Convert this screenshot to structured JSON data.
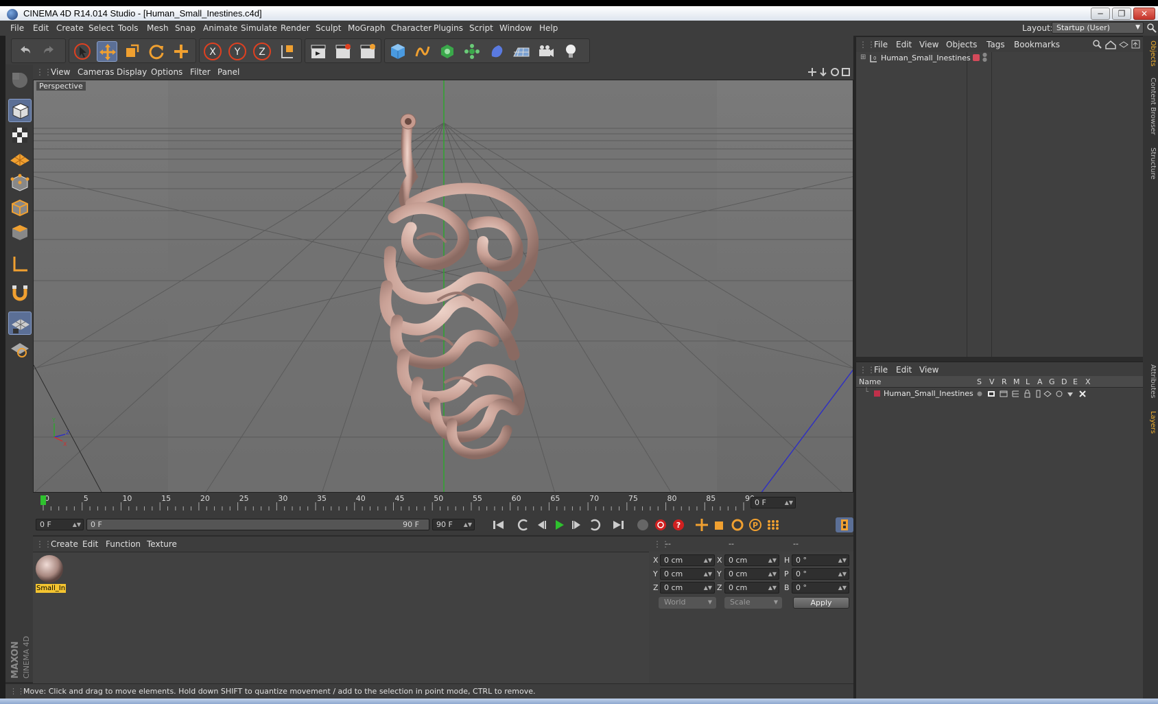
{
  "window": {
    "title": "CINEMA 4D R14.014 Studio - [Human_Small_Inestines.c4d]",
    "min": "─",
    "max": "❐",
    "close": "✕"
  },
  "menu": [
    "File",
    "Edit",
    "Create",
    "Select",
    "Tools",
    "Mesh",
    "Snap",
    "Animate",
    "Simulate",
    "Render",
    "Sculpt",
    "MoGraph",
    "Character",
    "Plugins",
    "Script",
    "Window",
    "Help"
  ],
  "layout": {
    "label": "Layout:",
    "value": "Startup (User)"
  },
  "viewport": {
    "menu": [
      "View",
      "Cameras",
      "Display",
      "Options",
      "Filter",
      "Panel"
    ],
    "label": "Perspective",
    "axes": {
      "x": "X",
      "y": "Y",
      "z": "Z"
    }
  },
  "timeline": {
    "ticks": [
      "0",
      "5",
      "10",
      "15",
      "20",
      "25",
      "30",
      "35",
      "40",
      "45",
      "50",
      "55",
      "60",
      "65",
      "70",
      "75",
      "80",
      "85",
      "90"
    ],
    "current_frame": "0 F",
    "start": "0 F",
    "range_start": "0 F",
    "range_end": "90 F",
    "end": "90 F"
  },
  "materials": {
    "menu": [
      "Create",
      "Edit",
      "Function",
      "Texture"
    ],
    "items": [
      {
        "name": "Small_In"
      }
    ]
  },
  "coordinates": {
    "headers": [
      "--",
      "--",
      "--"
    ],
    "rows": [
      {
        "a": "X",
        "av": "0 cm",
        "b": "X",
        "bv": "0 cm",
        "c": "H",
        "cv": "0 °"
      },
      {
        "a": "Y",
        "av": "0 cm",
        "b": "Y",
        "bv": "0 cm",
        "c": "P",
        "cv": "0 °"
      },
      {
        "a": "Z",
        "av": "0 cm",
        "b": "Z",
        "bv": "0 cm",
        "c": "B",
        "cv": "0 °"
      }
    ],
    "mode": "World",
    "transform": "Scale",
    "apply": "Apply"
  },
  "objects": {
    "menu": [
      "File",
      "Edit",
      "View",
      "Objects",
      "Tags",
      "Bookmarks"
    ],
    "items": [
      {
        "name": "Human_Small_Inestines",
        "color": "#d44a5a"
      }
    ]
  },
  "layers": {
    "menu": [
      "File",
      "Edit",
      "View"
    ],
    "columns": [
      "Name",
      "S",
      "V",
      "R",
      "M",
      "L",
      "A",
      "G",
      "D",
      "E",
      "X"
    ],
    "items": [
      {
        "name": "Human_Small_Inestines",
        "color": "#c0304a"
      }
    ]
  },
  "side_tabs": {
    "top": [
      "Objects",
      "Content Browser",
      "Structure"
    ],
    "bottom": [
      "Attributes",
      "Layers"
    ]
  },
  "status": "Move: Click and drag to move elements. Hold down SHIFT to quantize movement / add to the selection in point mode, CTRL to remove.",
  "brand": {
    "line1": "MAXON",
    "line2": "CINEMA 4D"
  },
  "colors": {
    "accent": "#f0a030",
    "active_tool": "#5b6f96",
    "bg": "#3d3d3d"
  }
}
